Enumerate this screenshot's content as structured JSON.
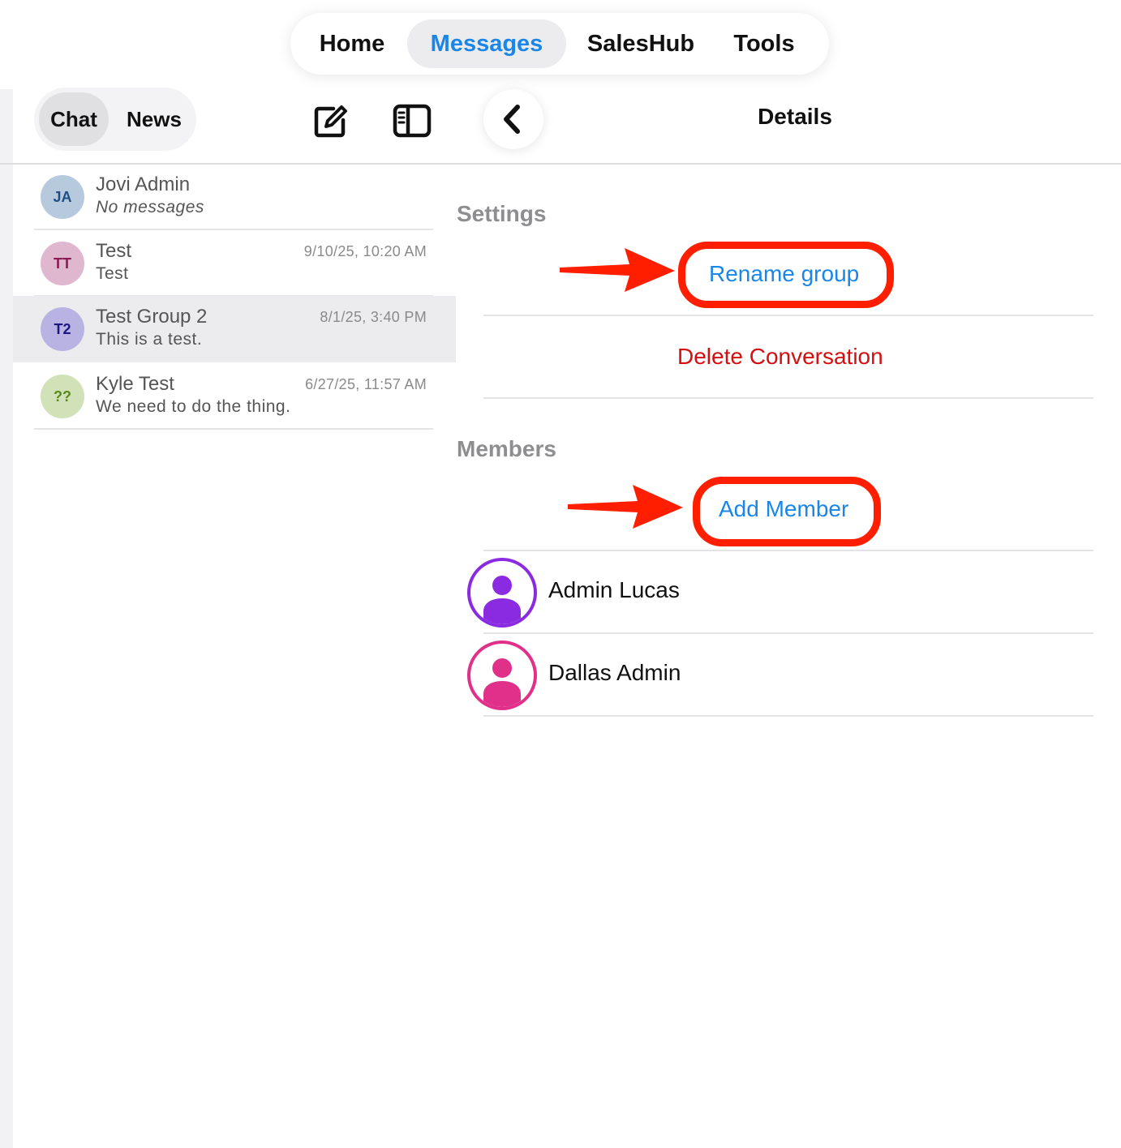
{
  "top_nav": {
    "tabs": [
      {
        "label": "Home",
        "active": false
      },
      {
        "label": "Messages",
        "active": true
      },
      {
        "label": "SalesHub",
        "active": false
      },
      {
        "label": "Tools",
        "active": false
      }
    ]
  },
  "sidebar": {
    "segments": [
      {
        "label": "Chat",
        "active": true
      },
      {
        "label": "News",
        "active": false
      }
    ],
    "compose_icon": "compose-icon",
    "sidebar_toggle_icon": "sidebar-toggle-icon",
    "chats": [
      {
        "initials": "JA",
        "name": "Jovi Admin",
        "preview": "No messages",
        "time": "",
        "avatar_bg": "#b7c9dc",
        "avatar_fg": "#1f4e85"
      },
      {
        "initials": "TT",
        "name": "Test",
        "preview": "Test",
        "time": "9/10/25, 10:20 AM",
        "avatar_bg": "#dfb7cf",
        "avatar_fg": "#8a1a52"
      },
      {
        "initials": "T2",
        "name": "Test Group 2",
        "preview": "This is a test.",
        "time": "8/1/25, 3:40 PM",
        "avatar_bg": "#b9b3e4",
        "avatar_fg": "#1f1780",
        "selected": true
      },
      {
        "initials": "??",
        "name": "Kyle Test",
        "preview": "We need to do the thing.",
        "time": "6/27/25, 11:57 AM",
        "avatar_bg": "#d1e2b8",
        "avatar_fg": "#5a8a1a"
      }
    ]
  },
  "details": {
    "back_icon": "chevron-left-icon",
    "title": "Details",
    "settings_label": "Settings",
    "rename_label": "Rename group",
    "delete_label": "Delete Conversation",
    "members_label": "Members",
    "add_member_label": "Add Member",
    "members": [
      {
        "name": "Admin Lucas",
        "color": "#8a2be2",
        "icon": "person-icon"
      },
      {
        "name": "Dallas Admin",
        "color": "#e0308a",
        "icon": "person-icon"
      }
    ]
  },
  "colors": {
    "accent": "#1a86e8",
    "danger": "#d50f0f",
    "annotation": "#ff1f00"
  }
}
